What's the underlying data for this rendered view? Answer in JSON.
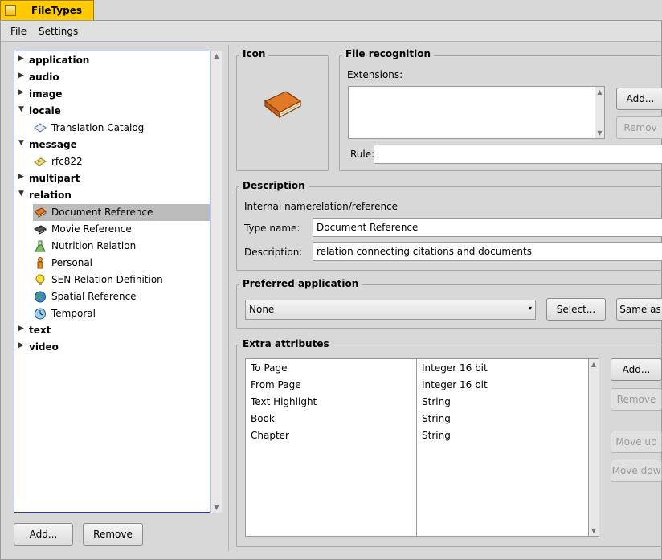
{
  "window": {
    "title": "FileTypes"
  },
  "menu": {
    "file": "File",
    "settings": "Settings"
  },
  "tree": {
    "items": [
      {
        "label": "application",
        "kind": "category",
        "expanded": false
      },
      {
        "label": "audio",
        "kind": "category",
        "expanded": false
      },
      {
        "label": "image",
        "kind": "category",
        "expanded": false
      },
      {
        "label": "locale",
        "kind": "category",
        "expanded": true
      },
      {
        "label": "Translation Catalog",
        "kind": "child",
        "icon": "catalog-icon"
      },
      {
        "label": "message",
        "kind": "category",
        "expanded": true
      },
      {
        "label": "rfc822",
        "kind": "child",
        "icon": "mail-icon"
      },
      {
        "label": "multipart",
        "kind": "category",
        "expanded": false
      },
      {
        "label": "relation",
        "kind": "category",
        "expanded": true
      },
      {
        "label": "Document Reference",
        "kind": "child",
        "icon": "book-icon",
        "selected": true
      },
      {
        "label": "Movie Reference",
        "kind": "child",
        "icon": "film-icon"
      },
      {
        "label": "Nutrition Relation",
        "kind": "child",
        "icon": "flask-icon"
      },
      {
        "label": "Personal",
        "kind": "child",
        "icon": "person-icon"
      },
      {
        "label": "SEN Relation Definition",
        "kind": "child",
        "icon": "bulb-icon"
      },
      {
        "label": "Spatial Reference",
        "kind": "child",
        "icon": "globe-icon"
      },
      {
        "label": "Temporal",
        "kind": "child",
        "icon": "clock-icon"
      },
      {
        "label": "text",
        "kind": "category",
        "expanded": false
      },
      {
        "label": "video",
        "kind": "category",
        "expanded": false
      }
    ],
    "add_label": "Add...",
    "remove_label": "Remove"
  },
  "icon_box": {
    "title": "Icon",
    "icon": "book-icon"
  },
  "recognition": {
    "title": "File recognition",
    "extensions_label": "Extensions:",
    "add_label": "Add...",
    "remove_label": "Remov",
    "rule_label": "Rule:",
    "rule_value": ""
  },
  "description": {
    "title": "Description",
    "internal_name_label": "Internal name:",
    "internal_name_value": "relation/reference",
    "type_name_label": "Type name:",
    "type_name_value": "Document Reference",
    "description_label": "Description:",
    "description_value": "relation connecting citations and documents"
  },
  "preferred": {
    "title": "Preferred application",
    "selected": "None",
    "select_label": "Select...",
    "same_as_label": "Same as"
  },
  "extra": {
    "title": "Extra attributes",
    "rows": [
      {
        "name": "To Page",
        "type": "Integer 16 bit"
      },
      {
        "name": "From Page",
        "type": "Integer 16 bit"
      },
      {
        "name": "Text Highlight",
        "type": "String"
      },
      {
        "name": "Book",
        "type": "String"
      },
      {
        "name": "Chapter",
        "type": "String"
      }
    ],
    "add_label": "Add...",
    "remove_label": "Remove",
    "move_up_label": "Move up",
    "move_down_label": "Move dow"
  },
  "colors": {
    "tab_yellow": "#ffcb00",
    "focus_blue": "#2a39b0",
    "selection_gray": "#bcbcbc"
  }
}
